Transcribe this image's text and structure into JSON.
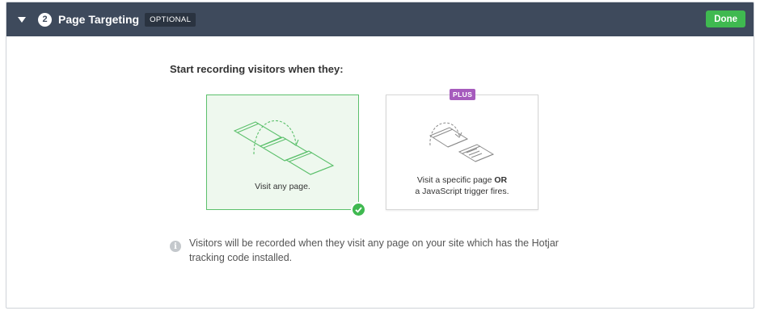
{
  "header": {
    "step_number": "2",
    "title": "Page Targeting",
    "optional_badge": "OPTIONAL",
    "done_label": "Done"
  },
  "main": {
    "prompt": "Start recording visitors when they:",
    "options": [
      {
        "label": "Visit any page.",
        "selected": true
      },
      {
        "label_line1_prefix": "Visit a specific page ",
        "label_line1_bold": "OR",
        "label_line2": "a JavaScript trigger fires.",
        "badge": "PLUS",
        "selected": false
      }
    ],
    "info_text": "Visitors will be recorded when they visit any page on your site which has the Hotjar tracking code installed."
  },
  "icons": {
    "collapse": "caret-down-icon",
    "info": "info-icon",
    "selected": "check-icon",
    "any_page": "pages-illustration-icon",
    "specific_page": "page-trigger-illustration-icon"
  },
  "colors": {
    "header_bg": "#3e4a5c",
    "accent_green": "#3fb950",
    "plus_purple": "#a65bbd",
    "selected_card_bg": "#eef8ee"
  }
}
